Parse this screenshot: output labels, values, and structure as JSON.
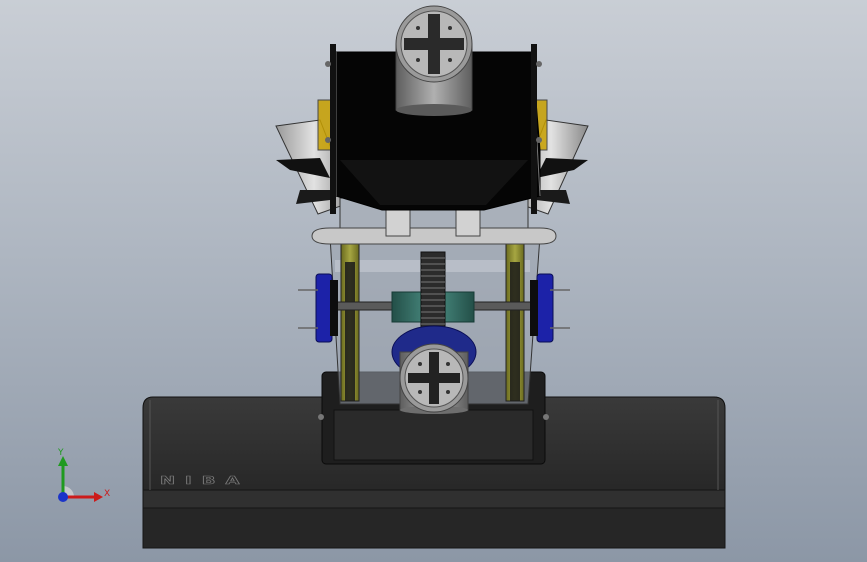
{
  "viewport": {
    "background_top": "#c9ced5",
    "background_bottom": "#8c97a6"
  },
  "model": {
    "base_logo_text": "NIBA",
    "base_color": "#2a2a2a",
    "frame_color": "#0a0a0a",
    "rail_color": "#8c8c2c",
    "motor_color": "#1c22a8",
    "gear_color": "#2f6f64",
    "wheel_color": "#8e8e8e"
  },
  "triad": {
    "y_label": "Y",
    "x_label": "X",
    "y_color": "#1f9a1f",
    "x_color": "#cc1b1b",
    "z_color": "#1b34c8"
  }
}
